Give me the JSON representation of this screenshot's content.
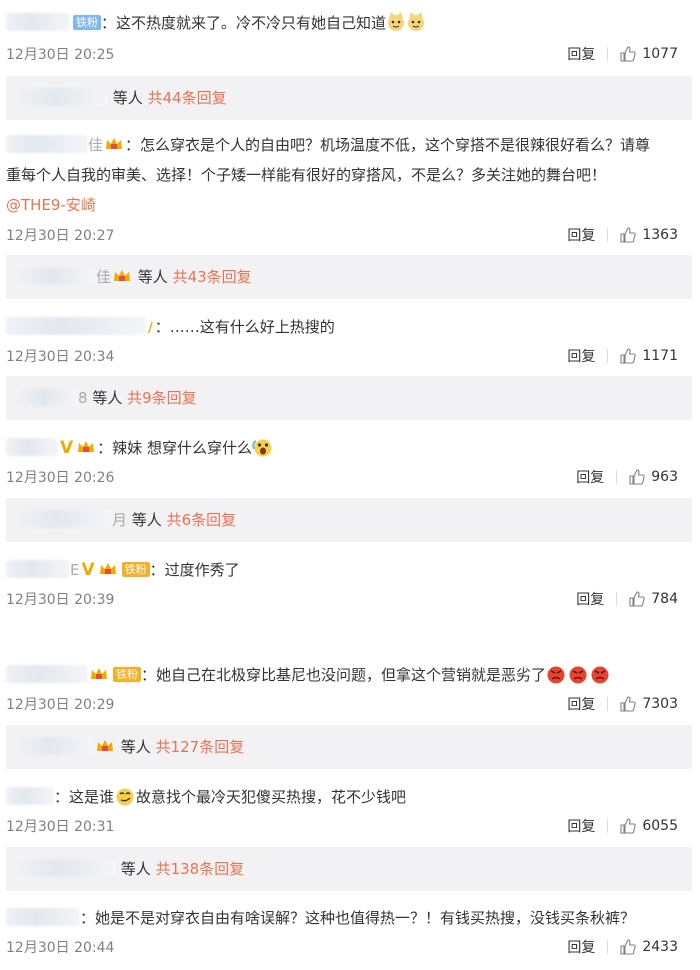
{
  "colors": {
    "link": "#eb7350",
    "meta": "#808080",
    "reply_bg": "#f2f2f5",
    "fan_badge": "#7eb8f2"
  },
  "comments": [
    {
      "badge": "铁粉",
      "text": "：这不热度就来了。冷不冷只有她自己知道",
      "time": "12月30日 20:25",
      "reply_label": "回复",
      "likes": "1077",
      "replies": {
        "prefix": "等人",
        "total": "共44条回复"
      }
    },
    {
      "name_tail": "佳",
      "text_line1": "：怎么穿衣是个人的自由吧？机场温度不低，这个穿搭不是很辣很好看么？请尊",
      "text_line2": "重每个人自我的审美、选择！个子矮一样能有很好的穿搭风，不是么？多关注她的舞台吧！",
      "mention": "@THE9-安崎",
      "time": "12月30日 20:27",
      "reply_label": "回复",
      "likes": "1363",
      "replies": {
        "name_tail": "佳",
        "prefix": "等人",
        "total": "共43条回复"
      }
    },
    {
      "text": "：……这有什么好上热搜的",
      "time": "12月30日 20:34",
      "reply_label": "回复",
      "likes": "1171",
      "replies": {
        "name_tail": "8",
        "prefix": "等人",
        "total": "共9条回复"
      }
    },
    {
      "text": "：辣妹 想穿什么穿什么",
      "time": "12月30日 20:26",
      "reply_label": "回复",
      "likes": "963",
      "replies": {
        "name_tail": "月",
        "prefix": "等人",
        "total": "共6条回复"
      }
    },
    {
      "name_tail": "E",
      "badge": "铁粉",
      "text": "：过度作秀了",
      "time": "12月30日 20:39",
      "reply_label": "回复",
      "likes": "784"
    },
    {
      "badge": "铁粉",
      "text": "：她自己在北极穿比基尼也没问题，但拿这个营销就是恶劣了",
      "time": "12月30日 20:29",
      "reply_label": "回复",
      "likes": "7303",
      "replies": {
        "prefix": "等人",
        "total": "共127条回复"
      }
    },
    {
      "text_a": "：这是谁",
      "text_b": "故意找个最冷天犯傻买热搜，花不少钱吧",
      "time": "12月30日 20:31",
      "reply_label": "回复",
      "likes": "6055",
      "replies": {
        "prefix": "等人",
        "total": "共138条回复"
      }
    },
    {
      "text": "：她是不是对穿衣自由有啥误解？这种也值得热一？！有钱买热搜，没钱买条秋裤？",
      "time": "12月30日 20:44",
      "reply_label": "回复",
      "likes": "2433"
    }
  ]
}
